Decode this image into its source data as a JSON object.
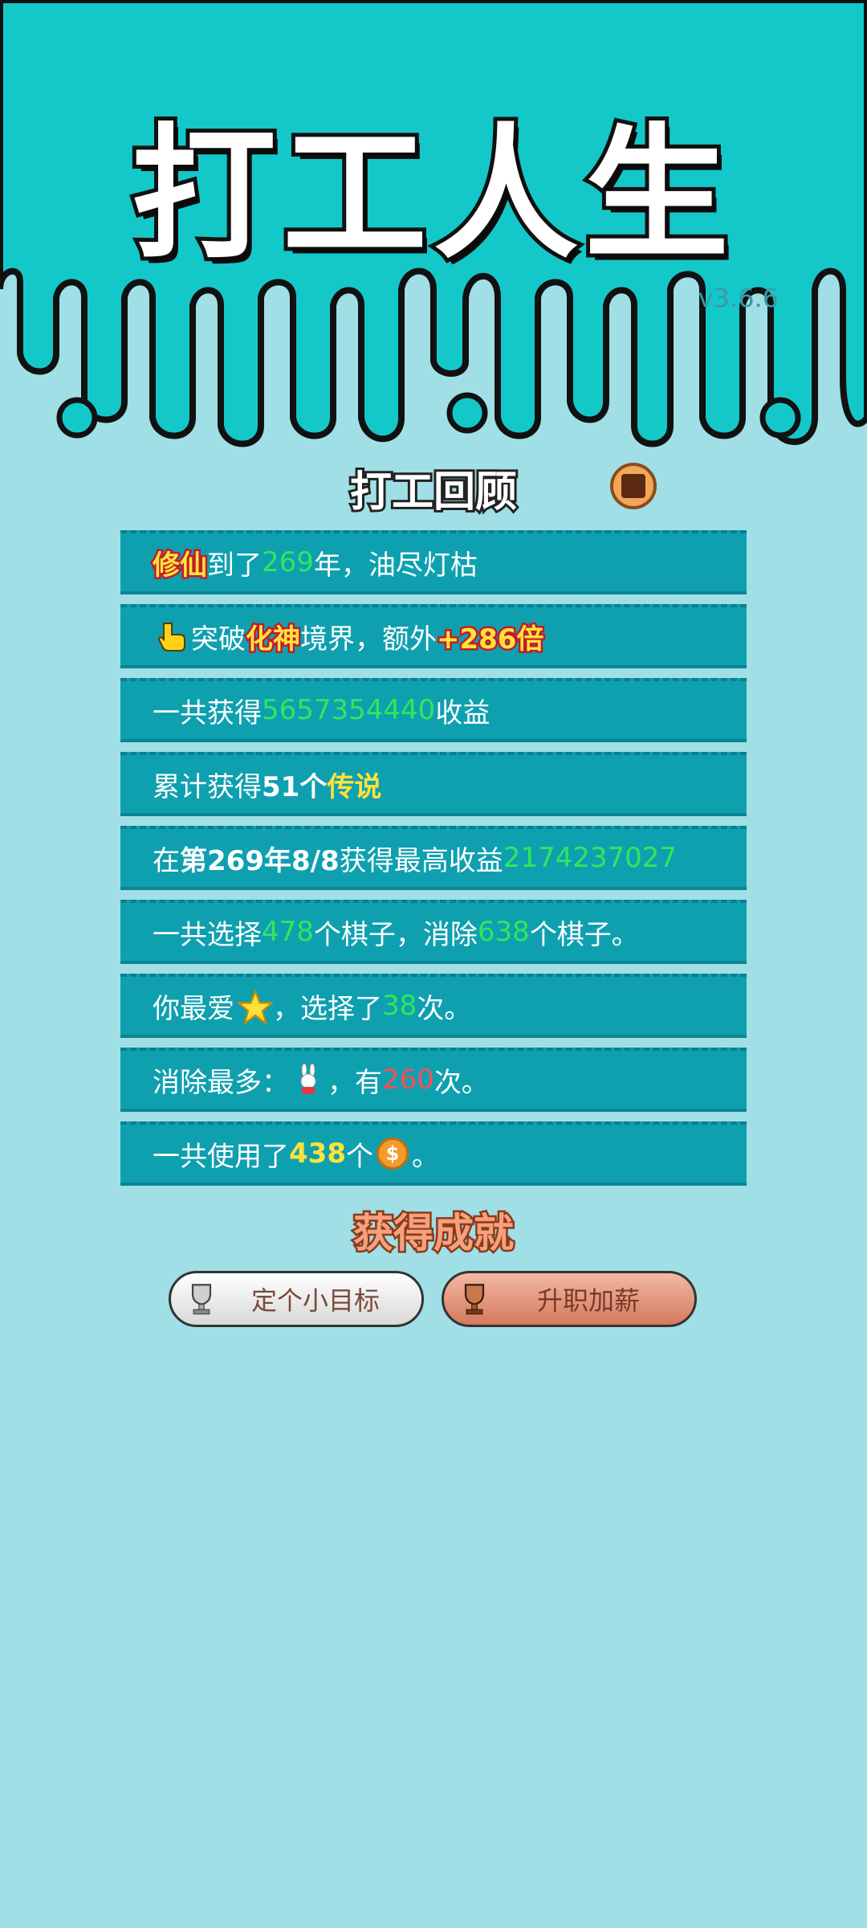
{
  "title": "打工人生",
  "version": "v3.6.6",
  "review": {
    "heading": "打工回顾",
    "rows": [
      {
        "parts": [
          "修仙",
          "到了",
          "269",
          "年，油尽灯枯"
        ]
      },
      {
        "parts": [
          "突破 ",
          "化神",
          " 境界，额外",
          "+286倍"
        ]
      },
      {
        "parts": [
          "一共获得",
          "5657354440",
          "收益"
        ]
      },
      {
        "parts": [
          "累计获得",
          "51个",
          "传说"
        ]
      },
      {
        "parts": [
          "在 ",
          "第269年8/8",
          " 获得最高收益",
          "2174237027"
        ]
      },
      {
        "parts": [
          "一共选择",
          "478",
          "个棋子，消除",
          "638",
          "个棋子。"
        ]
      },
      {
        "parts": [
          "你最爱",
          "，选择了",
          "38",
          "次。"
        ]
      },
      {
        "parts": [
          "消除最多：",
          "，有",
          "260",
          "次。"
        ]
      },
      {
        "parts": [
          "一共使用了",
          "438",
          "个",
          "。"
        ]
      }
    ]
  },
  "achievements": {
    "heading": "获得成就",
    "buttons": [
      {
        "label": "定个小目标",
        "icon": "silver-trophy-icon"
      },
      {
        "label": "升职加薪",
        "icon": "bronze-trophy-icon"
      }
    ]
  },
  "colors": {
    "header_bg": "#14c8c9",
    "body_bg": "#a0dfe6",
    "row_bg": "#0fa0b0",
    "highlight_green": "#2ee85a",
    "highlight_yellow": "#ffe23b",
    "highlight_red": "#ff4d5a"
  },
  "icons": [
    "pointing-hand-icon",
    "star-icon",
    "rabbit-icon",
    "coin-icon",
    "badge-icon"
  ]
}
